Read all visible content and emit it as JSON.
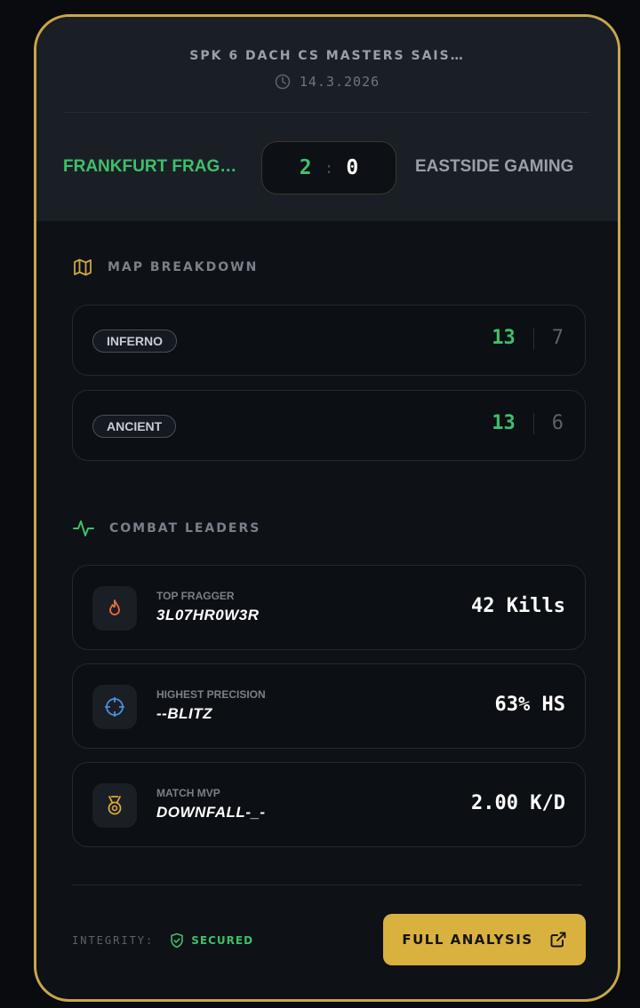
{
  "match": {
    "tournament": "SPK 6 DACH CS MASTERS SAIS…",
    "date": "14.3.2026",
    "team_a": "FRANKFURT FRAG…",
    "team_b": "EASTSIDE GAMING",
    "score_a": "2",
    "score_separator": ":",
    "score_b": "0"
  },
  "map_breakdown": {
    "title": "MAP BREAKDOWN",
    "maps": [
      {
        "name": "INFERNO",
        "score_a": "13",
        "score_b": "7"
      },
      {
        "name": "ANCIENT",
        "score_a": "13",
        "score_b": "6"
      }
    ]
  },
  "combat_leaders": {
    "title": "COMBAT LEADERS",
    "leaders": [
      {
        "label": "TOP FRAGGER",
        "player": "3L07HR0W3R",
        "value": "42 Kills",
        "icon": "flame-icon"
      },
      {
        "label": "HIGHEST PRECISION",
        "player": "--BLITZ",
        "value": "63% HS",
        "icon": "crosshair-icon"
      },
      {
        "label": "MATCH MVP",
        "player": "DOWNFALL-_-",
        "value": "2.00 K/D",
        "icon": "medal-icon"
      }
    ]
  },
  "footer": {
    "integrity_label": "INTEGRITY:",
    "integrity_status": "SECURED",
    "analysis_button": "FULL ANALYSIS"
  },
  "colors": {
    "accent_gold": "#c9a64a",
    "win_green": "#3fbf6a",
    "background": "#0e1116",
    "header_bg": "#1a1f26",
    "button_gold": "#d9b13f"
  }
}
